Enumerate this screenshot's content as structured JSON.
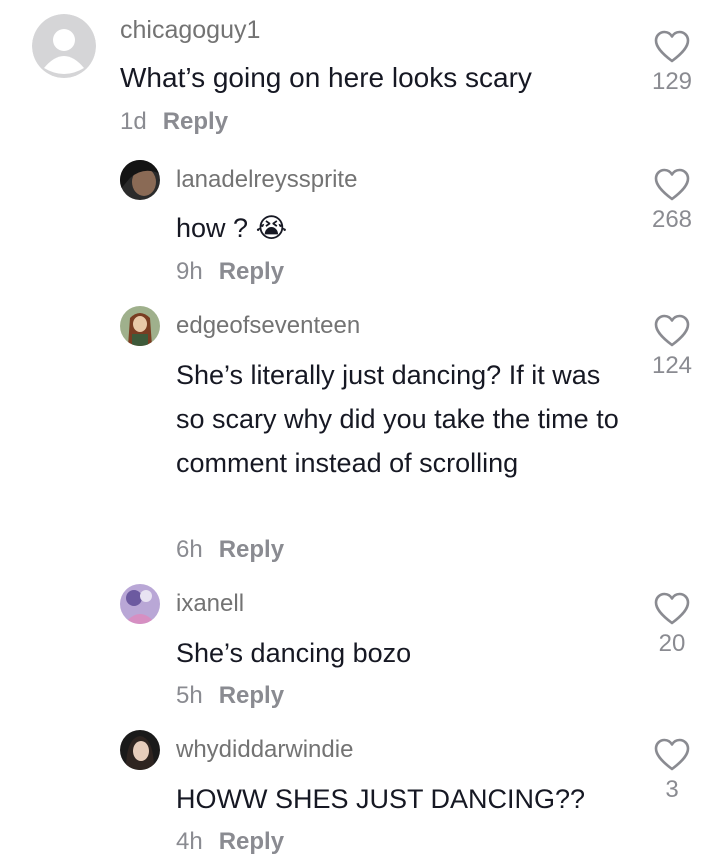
{
  "comments": [
    {
      "username": "chicagoguy1",
      "text": "What’s going on here looks scary",
      "time": "1d",
      "reply_label": "Reply",
      "likes": "129",
      "avatar": "default-avatar"
    },
    {
      "username": "lanadelreyssprite",
      "text": "how ?",
      "emoji": "😭",
      "time": "9h",
      "reply_label": "Reply",
      "likes": "268",
      "avatar": "user-photo"
    },
    {
      "username": "edgeofseventeen",
      "text": "She’s literally just dancing? If it was so scary why did you take the time to comment instead of scrolling",
      "time": "6h",
      "reply_label": "Reply",
      "likes": "124",
      "avatar": "user-photo"
    },
    {
      "username": "ixanell",
      "text": "She’s dancing bozo",
      "time": "5h",
      "reply_label": "Reply",
      "likes": "20",
      "avatar": "user-photo"
    },
    {
      "username": "whydiddarwindie",
      "text": "HOWW SHES JUST DANCING??",
      "time": "4h",
      "reply_label": "Reply",
      "likes": "3",
      "avatar": "user-photo"
    }
  ],
  "colors": {
    "text": "#161823",
    "secondary": "#8a8b91",
    "username": "#737373",
    "background": "#ffffff"
  }
}
